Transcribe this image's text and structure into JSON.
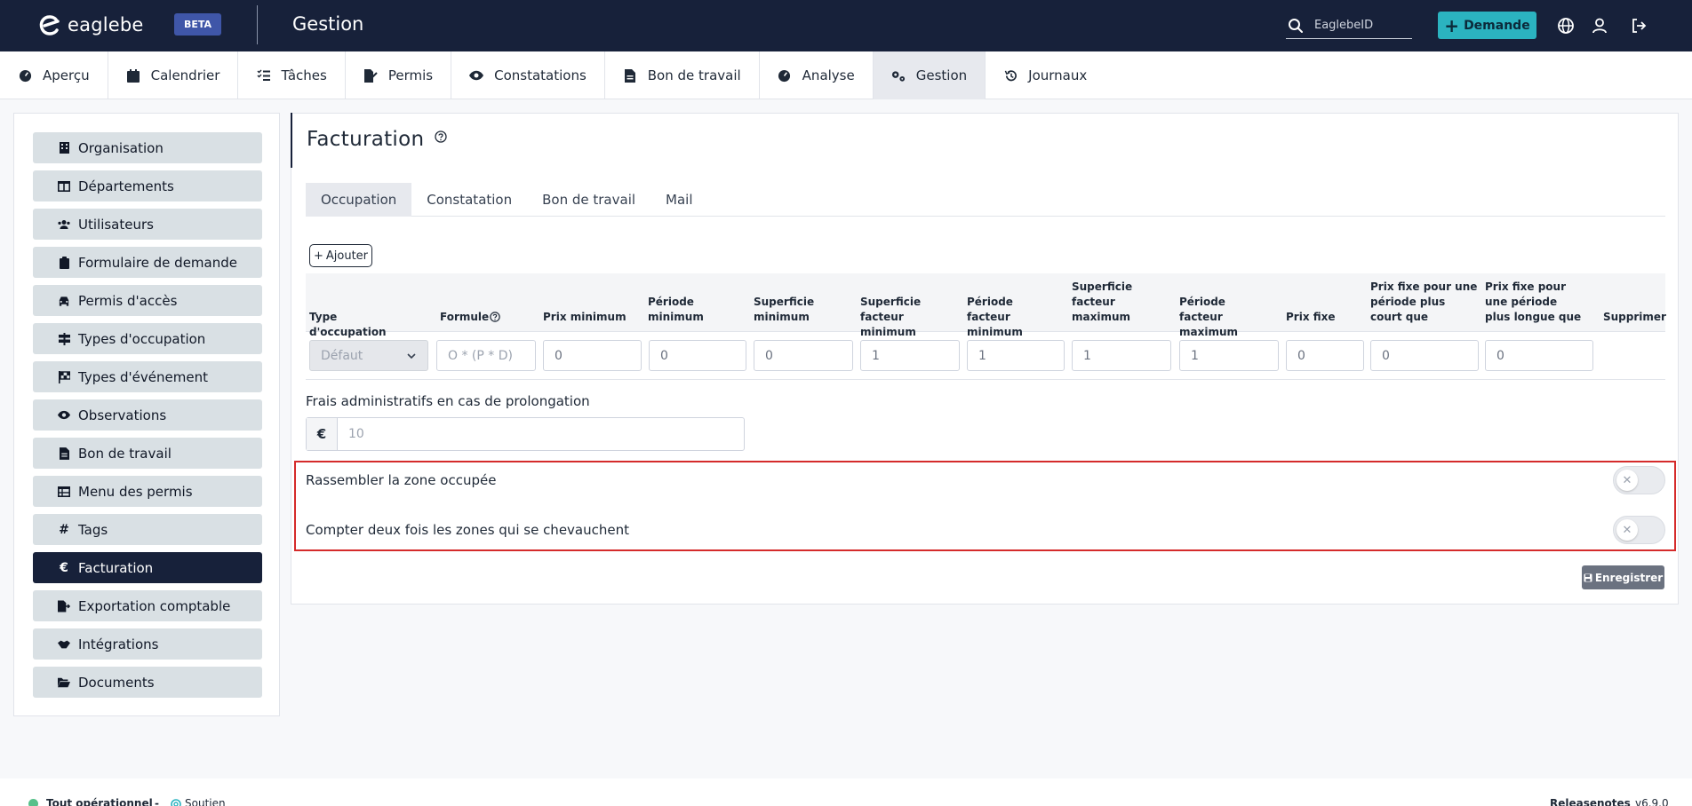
{
  "header": {
    "logo_text": "eaglebe",
    "beta": "BETA",
    "app_title": "Gestion",
    "search_placeholder": "EaglebeID",
    "demande_label": "Demande"
  },
  "nav": [
    {
      "label": "Aperçu",
      "icon": "gauge-icon"
    },
    {
      "label": "Calendrier",
      "icon": "calendar-icon"
    },
    {
      "label": "Tâches",
      "icon": "checklist-icon"
    },
    {
      "label": "Permis",
      "icon": "file-signature-icon"
    },
    {
      "label": "Constatations",
      "icon": "eye-icon"
    },
    {
      "label": "Bon de travail",
      "icon": "file-icon"
    },
    {
      "label": "Analyse",
      "icon": "gauge-icon"
    },
    {
      "label": "Gestion",
      "icon": "cogs-icon",
      "active": true
    },
    {
      "label": "Journaux",
      "icon": "history-icon"
    }
  ],
  "sidebar": [
    {
      "label": "Organisation",
      "icon": "building-icon"
    },
    {
      "label": "Départements",
      "icon": "table-columns-icon"
    },
    {
      "label": "Utilisateurs",
      "icon": "users-icon"
    },
    {
      "label": "Formulaire de demande",
      "icon": "clipboard-icon"
    },
    {
      "label": "Permis d'accès",
      "icon": "car-icon"
    },
    {
      "label": "Types d'occupation",
      "icon": "signs-icon"
    },
    {
      "label": "Types d'événement",
      "icon": "flag-icon"
    },
    {
      "label": "Observations",
      "icon": "eye-icon"
    },
    {
      "label": "Bon de travail",
      "icon": "file-icon"
    },
    {
      "label": "Menu des permis",
      "icon": "table-icon"
    },
    {
      "label": "Tags",
      "icon": "hashtag-icon"
    },
    {
      "label": "Facturation",
      "icon": "euro-icon",
      "active": true
    },
    {
      "label": "Exportation comptable",
      "icon": "file-export-icon"
    },
    {
      "label": "Intégrations",
      "icon": "handshake-icon"
    },
    {
      "label": "Documents",
      "icon": "folder-open-icon"
    }
  ],
  "main": {
    "title": "Facturation",
    "tabs": [
      "Occupation",
      "Constatation",
      "Bon de travail",
      "Mail"
    ],
    "active_tab": "Occupation",
    "add_label": "Ajouter",
    "table": {
      "headers": [
        "Type d'occupation",
        "Formule",
        "Prix minimum",
        "Période minimum",
        "Superficie minimum",
        "Superficie facteur minimum",
        "Période facteur minimum",
        "Superficie facteur maximum",
        "Période facteur maximum",
        "Prix fixe",
        "Prix fixe pour une période plus court que",
        "Prix fixe pour une période plus longue que",
        "Supprimer"
      ],
      "row": {
        "type": "Défaut",
        "formula_placeholder": "O * (P  * D)",
        "values": [
          "0",
          "0",
          "0",
          "1",
          "1",
          "1",
          "1",
          "0",
          "0",
          "0"
        ]
      }
    },
    "frais_label": "Frais administratifs en cas de prolongation",
    "frais_currency": "€",
    "frais_value": "10",
    "toggles": [
      {
        "label": "Rassembler la zone occupée",
        "on": false
      },
      {
        "label": "Compter deux fois les zones qui se chevauchent",
        "on": false
      }
    ],
    "save_label": "Enregistrer"
  },
  "footer": {
    "status": "Tout opérationnel",
    "separator": "-",
    "support": "Soutien",
    "release_notes": "Releasenotes",
    "version": "v6.9.0"
  },
  "colors": {
    "navbar": "#17213a",
    "accent": "#2bb3c0",
    "beta": "#3f56a8",
    "highlight": "#d52b2b",
    "status_ok": "#57c08a"
  }
}
